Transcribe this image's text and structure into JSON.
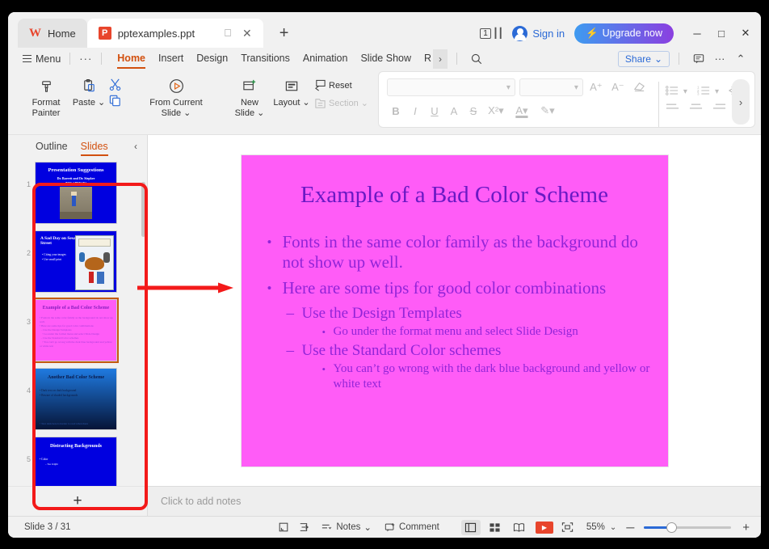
{
  "window": {
    "tabs": [
      {
        "label": "Home",
        "icon": "wps-logo"
      },
      {
        "label": "pptexamples.ppt",
        "icon": "powerpoint-icon"
      }
    ],
    "new_tab": "+",
    "page_count_badge": "1",
    "sign_in": "Sign in",
    "upgrade": "Upgrade now",
    "minimize": "─",
    "maximize": "□",
    "close": "✕"
  },
  "ribbon": {
    "menu": "Menu",
    "overflow": "···",
    "tabs": [
      {
        "label": "Home",
        "active": true
      },
      {
        "label": "Insert",
        "active": false
      },
      {
        "label": "Design",
        "active": false
      },
      {
        "label": "Transitions",
        "active": false
      },
      {
        "label": "Animation",
        "active": false
      },
      {
        "label": "Slide Show",
        "active": false
      },
      {
        "label": "R",
        "active": false
      }
    ],
    "next_arrow": "›",
    "search_icon": "search-icon",
    "share": "Share",
    "share_caret": "⌄",
    "comment_icon": "comment-icon",
    "more_icon": "···",
    "collapse_icon": "⌃",
    "expander": "›"
  },
  "toolbar": {
    "format_painter": "Format\nPainter",
    "format_painter_l1": "Format",
    "format_painter_l2": "Painter",
    "paste": "Paste",
    "paste_caret": "⌄",
    "cut_icon": "scissors-icon",
    "copy_icon": "copy-icon",
    "from_current_slide_l1": "From Current",
    "from_current_slide_l2": "Slide",
    "from_current_caret": "⌄",
    "new_slide_l1": "New",
    "new_slide_l2": "Slide",
    "new_slide_caret": "⌄",
    "layout": "Layout",
    "layout_caret": "⌄",
    "reset": "Reset",
    "section": "Section",
    "section_caret": "⌄",
    "font_name": "",
    "font_size": "",
    "grow_font": "A⁺",
    "shrink_font": "A⁻",
    "clear_format": "◇",
    "bold": "B",
    "italic": "I",
    "underline": "U",
    "text_shadow": "A",
    "strikethrough": "S",
    "superscript": "X²",
    "font_color": "A",
    "highlight": "✎",
    "bullets_icon": "bullet-list-icon",
    "numbering_icon": "numbered-list-icon",
    "decrease_indent_icon": "decrease-indent-icon",
    "align_left_icon": "align-left-icon",
    "align_center_icon": "align-center-icon",
    "align_right_icon": "align-right-icon",
    "align_justify_icon": "align-justify-icon"
  },
  "panel": {
    "outline_tab": "Outline",
    "slides_tab": "Slides",
    "collapse": "‹",
    "add_slide": "+",
    "thumbnails": [
      {
        "number": "1",
        "title": "Presentation Suggestions",
        "subtitle": "Dr. Barrett and Dr. Siepker",
        "subtitle2": "BIOL CHEM 492",
        "selected": false,
        "bg": "#0000e0"
      },
      {
        "number": "2",
        "title": "A Sad Day on Sesame Street",
        "bullets": [
          "Citing your images",
          "Use small print"
        ],
        "selected": false,
        "bg": "#0000e0"
      },
      {
        "number": "3",
        "title": "Example of a Bad Color Scheme",
        "selected": true,
        "bg": "#ff5cf7"
      },
      {
        "number": "4",
        "title": "Another Bad Color Scheme",
        "bullets": [
          "Dark text on dark background",
          "Beware of shaded backgrounds"
        ],
        "selected": false,
        "bg": "#1560d8"
      },
      {
        "number": "5",
        "title": "Distracting Backgrounds",
        "bullets": [
          "Color",
          "Too bright"
        ],
        "selected": false,
        "bg": "#0000e0"
      }
    ]
  },
  "slide": {
    "background_color": "#ff5cf7",
    "title_color": "#6a19c4",
    "body_color": "#9224d8",
    "title": "Example of a Bad Color Scheme",
    "bullets": [
      {
        "level": 1,
        "bullet": "•",
        "text": "Fonts in the same color family as the background do not show up well."
      },
      {
        "level": 1,
        "bullet": "•",
        "text": "Here are some tips for good color combinations"
      },
      {
        "level": 2,
        "bullet": "–",
        "text": "Use the Design Templates"
      },
      {
        "level": 3,
        "bullet": "•",
        "text": "Go under the format menu and select Slide Design"
      },
      {
        "level": 2,
        "bullet": "–",
        "text": "Use the Standard Color schemes"
      },
      {
        "level": 3,
        "bullet": "•",
        "text": "You can’t go wrong with the dark blue background and yellow or white text"
      }
    ]
  },
  "notes": {
    "placeholder": "Click to add notes"
  },
  "status": {
    "slide_counter": "Slide 3 / 31",
    "fit_icon": "fit-slide-icon",
    "expand_icon": "expand-icon",
    "notes": "Notes",
    "notes_caret": "⌄",
    "comment": "Comment",
    "view_normal_icon": "normal-view-icon",
    "view_sorter_icon": "slide-sorter-icon",
    "view_reading_icon": "reading-view-icon",
    "play_icon": "play-icon",
    "fullscreen_icon": "fullscreen-icon",
    "zoom_level": "55%",
    "zoom_caret": "⌄",
    "zoom_out": "─",
    "zoom_in": "+"
  },
  "annotations": {
    "highlight_color": "#f31a1a",
    "rect_target": "slide-thumbnail-panel",
    "arrow_direction": "right"
  }
}
